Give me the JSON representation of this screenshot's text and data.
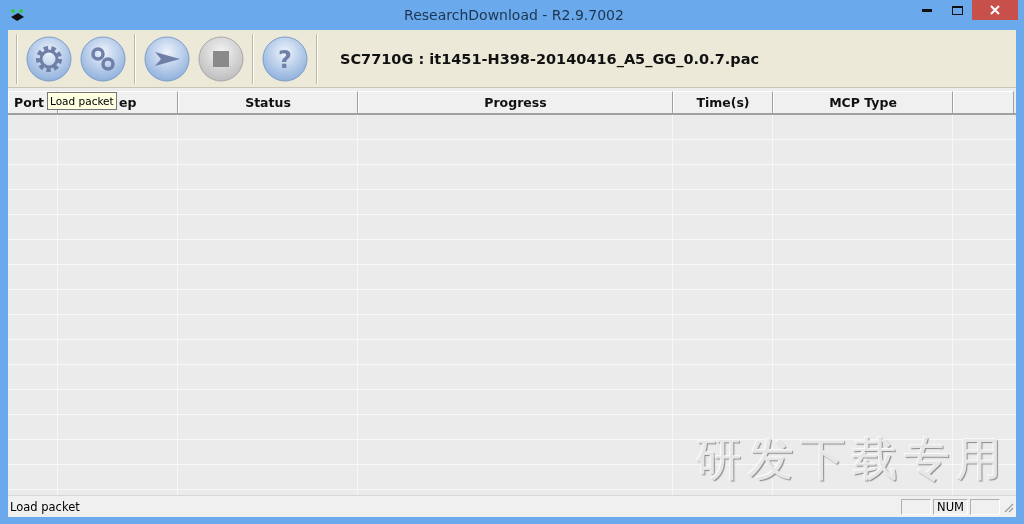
{
  "window": {
    "title": "ResearchDownload - R2.9.7002"
  },
  "toolbar": {
    "buttons": [
      {
        "kind": "gear",
        "disabled": false
      },
      {
        "kind": "gears",
        "disabled": false
      },
      {
        "kind": "start",
        "disabled": false
      },
      {
        "kind": "stop",
        "disabled": true
      },
      {
        "kind": "help",
        "disabled": false,
        "label": "?"
      }
    ],
    "package": "SC7710G : it1451-H398-20140416_A5_GG_0.0.7.pac"
  },
  "tooltip": "Load packet",
  "table": {
    "columns": [
      "Port",
      "ep",
      "Status",
      "Progress",
      "Time(s)",
      "MCP Type",
      ""
    ]
  },
  "background_text": "研发下载专用",
  "status_bar": {
    "message": "Load packet",
    "num_indicator": "NUM"
  }
}
